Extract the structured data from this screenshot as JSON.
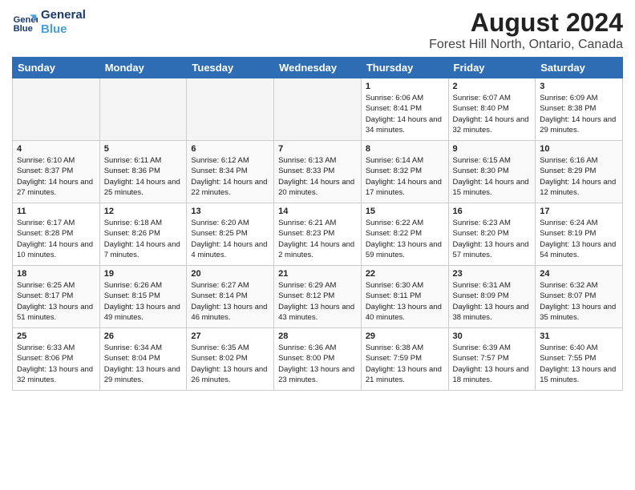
{
  "logo": {
    "line1": "General",
    "line2": "Blue"
  },
  "title": "August 2024",
  "subtitle": "Forest Hill North, Ontario, Canada",
  "days_of_week": [
    "Sunday",
    "Monday",
    "Tuesday",
    "Wednesday",
    "Thursday",
    "Friday",
    "Saturday"
  ],
  "weeks": [
    [
      {
        "day": "",
        "info": ""
      },
      {
        "day": "",
        "info": ""
      },
      {
        "day": "",
        "info": ""
      },
      {
        "day": "",
        "info": ""
      },
      {
        "day": "1",
        "info": "Sunrise: 6:06 AM\nSunset: 8:41 PM\nDaylight: 14 hours and 34 minutes."
      },
      {
        "day": "2",
        "info": "Sunrise: 6:07 AM\nSunset: 8:40 PM\nDaylight: 14 hours and 32 minutes."
      },
      {
        "day": "3",
        "info": "Sunrise: 6:09 AM\nSunset: 8:38 PM\nDaylight: 14 hours and 29 minutes."
      }
    ],
    [
      {
        "day": "4",
        "info": "Sunrise: 6:10 AM\nSunset: 8:37 PM\nDaylight: 14 hours and 27 minutes."
      },
      {
        "day": "5",
        "info": "Sunrise: 6:11 AM\nSunset: 8:36 PM\nDaylight: 14 hours and 25 minutes."
      },
      {
        "day": "6",
        "info": "Sunrise: 6:12 AM\nSunset: 8:34 PM\nDaylight: 14 hours and 22 minutes."
      },
      {
        "day": "7",
        "info": "Sunrise: 6:13 AM\nSunset: 8:33 PM\nDaylight: 14 hours and 20 minutes."
      },
      {
        "day": "8",
        "info": "Sunrise: 6:14 AM\nSunset: 8:32 PM\nDaylight: 14 hours and 17 minutes."
      },
      {
        "day": "9",
        "info": "Sunrise: 6:15 AM\nSunset: 8:30 PM\nDaylight: 14 hours and 15 minutes."
      },
      {
        "day": "10",
        "info": "Sunrise: 6:16 AM\nSunset: 8:29 PM\nDaylight: 14 hours and 12 minutes."
      }
    ],
    [
      {
        "day": "11",
        "info": "Sunrise: 6:17 AM\nSunset: 8:28 PM\nDaylight: 14 hours and 10 minutes."
      },
      {
        "day": "12",
        "info": "Sunrise: 6:18 AM\nSunset: 8:26 PM\nDaylight: 14 hours and 7 minutes."
      },
      {
        "day": "13",
        "info": "Sunrise: 6:20 AM\nSunset: 8:25 PM\nDaylight: 14 hours and 4 minutes."
      },
      {
        "day": "14",
        "info": "Sunrise: 6:21 AM\nSunset: 8:23 PM\nDaylight: 14 hours and 2 minutes."
      },
      {
        "day": "15",
        "info": "Sunrise: 6:22 AM\nSunset: 8:22 PM\nDaylight: 13 hours and 59 minutes."
      },
      {
        "day": "16",
        "info": "Sunrise: 6:23 AM\nSunset: 8:20 PM\nDaylight: 13 hours and 57 minutes."
      },
      {
        "day": "17",
        "info": "Sunrise: 6:24 AM\nSunset: 8:19 PM\nDaylight: 13 hours and 54 minutes."
      }
    ],
    [
      {
        "day": "18",
        "info": "Sunrise: 6:25 AM\nSunset: 8:17 PM\nDaylight: 13 hours and 51 minutes."
      },
      {
        "day": "19",
        "info": "Sunrise: 6:26 AM\nSunset: 8:15 PM\nDaylight: 13 hours and 49 minutes."
      },
      {
        "day": "20",
        "info": "Sunrise: 6:27 AM\nSunset: 8:14 PM\nDaylight: 13 hours and 46 minutes."
      },
      {
        "day": "21",
        "info": "Sunrise: 6:29 AM\nSunset: 8:12 PM\nDaylight: 13 hours and 43 minutes."
      },
      {
        "day": "22",
        "info": "Sunrise: 6:30 AM\nSunset: 8:11 PM\nDaylight: 13 hours and 40 minutes."
      },
      {
        "day": "23",
        "info": "Sunrise: 6:31 AM\nSunset: 8:09 PM\nDaylight: 13 hours and 38 minutes."
      },
      {
        "day": "24",
        "info": "Sunrise: 6:32 AM\nSunset: 8:07 PM\nDaylight: 13 hours and 35 minutes."
      }
    ],
    [
      {
        "day": "25",
        "info": "Sunrise: 6:33 AM\nSunset: 8:06 PM\nDaylight: 13 hours and 32 minutes."
      },
      {
        "day": "26",
        "info": "Sunrise: 6:34 AM\nSunset: 8:04 PM\nDaylight: 13 hours and 29 minutes."
      },
      {
        "day": "27",
        "info": "Sunrise: 6:35 AM\nSunset: 8:02 PM\nDaylight: 13 hours and 26 minutes."
      },
      {
        "day": "28",
        "info": "Sunrise: 6:36 AM\nSunset: 8:00 PM\nDaylight: 13 hours and 23 minutes."
      },
      {
        "day": "29",
        "info": "Sunrise: 6:38 AM\nSunset: 7:59 PM\nDaylight: 13 hours and 21 minutes."
      },
      {
        "day": "30",
        "info": "Sunrise: 6:39 AM\nSunset: 7:57 PM\nDaylight: 13 hours and 18 minutes."
      },
      {
        "day": "31",
        "info": "Sunrise: 6:40 AM\nSunset: 7:55 PM\nDaylight: 13 hours and 15 minutes."
      }
    ]
  ]
}
